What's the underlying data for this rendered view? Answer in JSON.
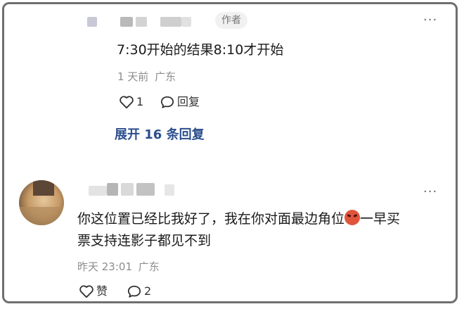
{
  "comment_top": {
    "author_tag": "作者",
    "text": "7:30开始的结果8:10才开始",
    "time": "1 天前",
    "location": "广东",
    "like_count": "1",
    "reply_label": "回复",
    "expand_label": "展开 16 条回复"
  },
  "comment_bottom": {
    "text_line1": "你这位置已经比我好了，我在你对面最边角位",
    "text_line1_tail": "一早买",
    "text_line2": "票支持连影子都见不到",
    "time": "昨天 23:01",
    "location": "广东",
    "like_label": "赞",
    "reply_count": "2"
  },
  "more_glyph": "···",
  "colors": {
    "link": "#2c4e8d",
    "meta": "#8c8c8c",
    "text": "#1a1a1a"
  },
  "icons": [
    "heart-outline-icon",
    "speech-bubble-icon",
    "more-dots-icon",
    "devil-emoji-icon"
  ]
}
